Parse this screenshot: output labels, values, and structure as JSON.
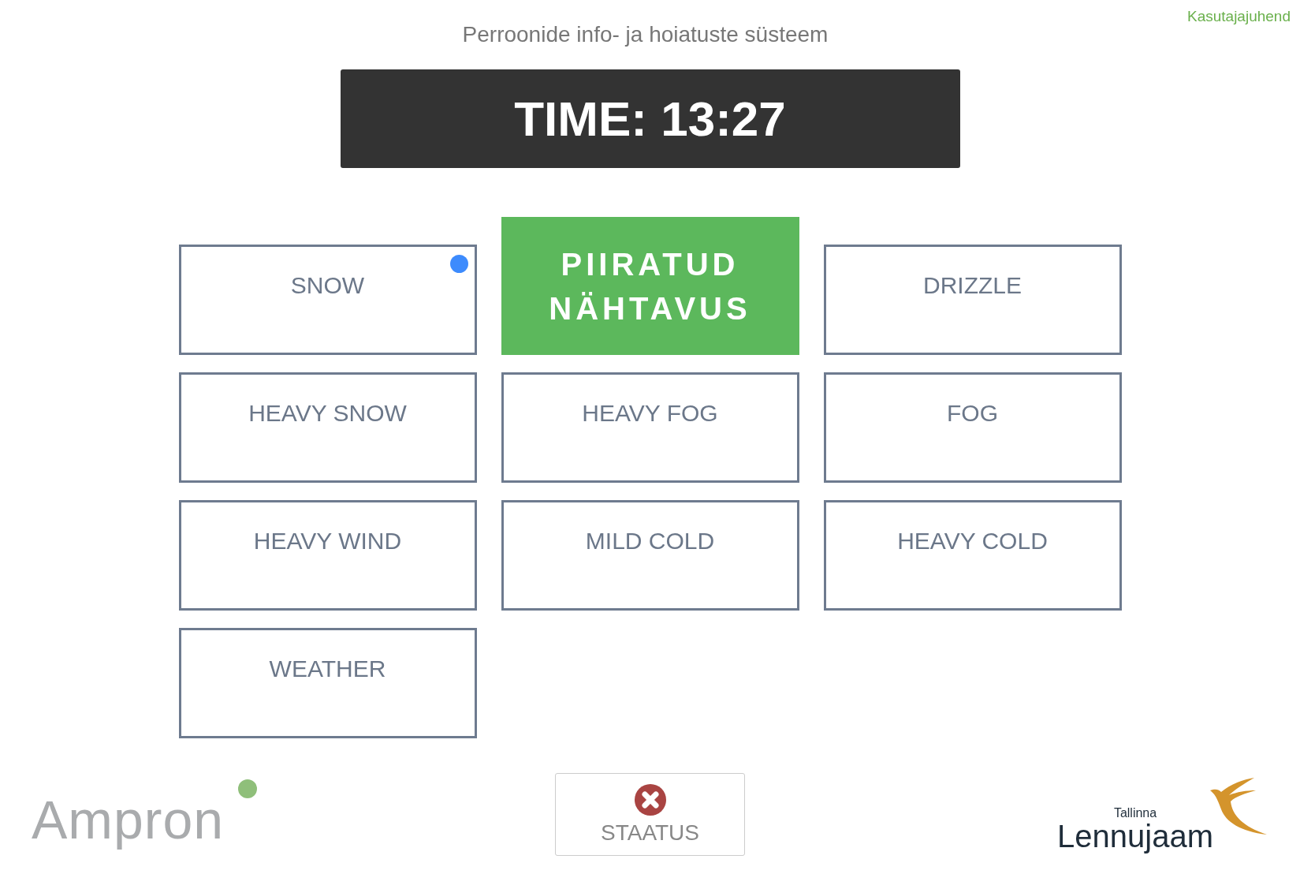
{
  "header": {
    "title": "Perroonide info- ja hoiatuste süsteem",
    "help_link": "Kasutajajuhend"
  },
  "clock": {
    "text": "TIME: 13:27"
  },
  "buttons": [
    {
      "label": "SNOW",
      "selected": false,
      "flagged": true
    },
    {
      "label": "PIIRATUD NÄHTAVUS",
      "selected": true,
      "flagged": false
    },
    {
      "label": "DRIZZLE",
      "selected": false,
      "flagged": false
    },
    {
      "label": "HEAVY SNOW",
      "selected": false,
      "flagged": false
    },
    {
      "label": "HEAVY FOG",
      "selected": false,
      "flagged": false
    },
    {
      "label": "FOG",
      "selected": false,
      "flagged": false
    },
    {
      "label": "HEAVY WIND",
      "selected": false,
      "flagged": false
    },
    {
      "label": "MILD COLD",
      "selected": false,
      "flagged": false
    },
    {
      "label": "HEAVY COLD",
      "selected": false,
      "flagged": false
    },
    {
      "label": "WEATHER",
      "selected": false,
      "flagged": false
    }
  ],
  "status_button": {
    "label": "STAATUS",
    "error": true
  },
  "logos": {
    "left": {
      "text": "Ampron"
    },
    "right": {
      "small_text": "Tallinna",
      "text": "Lennujaam"
    }
  }
}
